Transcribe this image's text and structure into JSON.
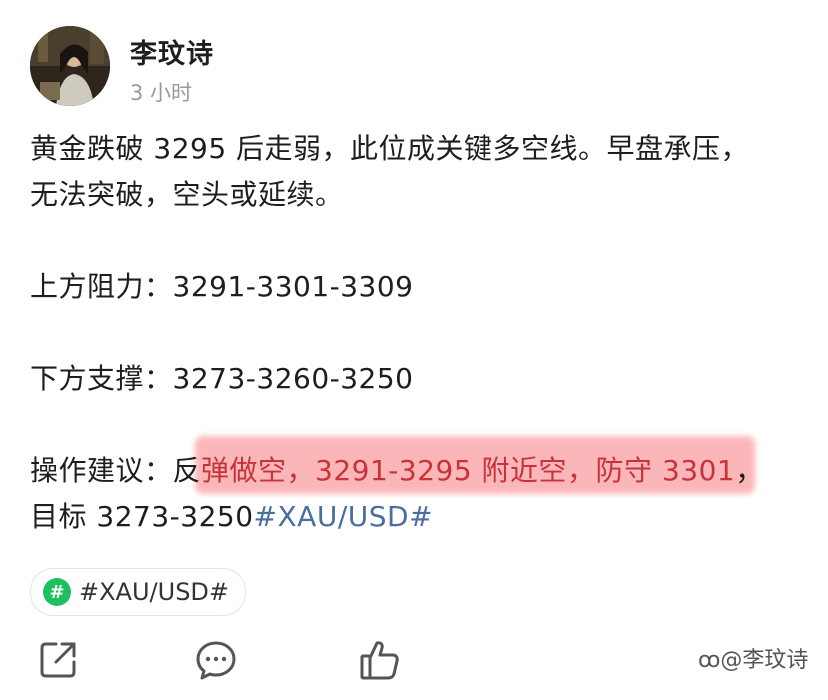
{
  "author": {
    "name": "李玟诗",
    "time": "3 小时"
  },
  "post": {
    "line1": "黄金跌破 3295 后走弱，此位成关键多空线。早盘承压，",
    "line2": "无法突破，空头或延续。",
    "resistance_label": "上方阻力：",
    "resistance_value": "3291-3301-3309",
    "support_label": "下方支撑：",
    "support_value": "3273-3260-3250",
    "advice_label": "操作建议：",
    "advice_text_a": "反",
    "advice_text_highlight": "弹做空，3291-3295 附近空，防守 3301",
    "advice_text_end": "，",
    "target_text": "目标 3273-3250",
    "target_hashtag": "#XAU/USD#"
  },
  "topic_chip": {
    "icon": "hash-icon",
    "icon_glyph": "#",
    "label": "#XAU/USD#",
    "icon_color": "#1fbf5d"
  },
  "actions": [
    "share-icon",
    "comment-icon",
    "like-icon"
  ],
  "watermark": "@李玟诗",
  "colors": {
    "highlight": "#f97c80",
    "hashtag": "#4a6ea0"
  }
}
